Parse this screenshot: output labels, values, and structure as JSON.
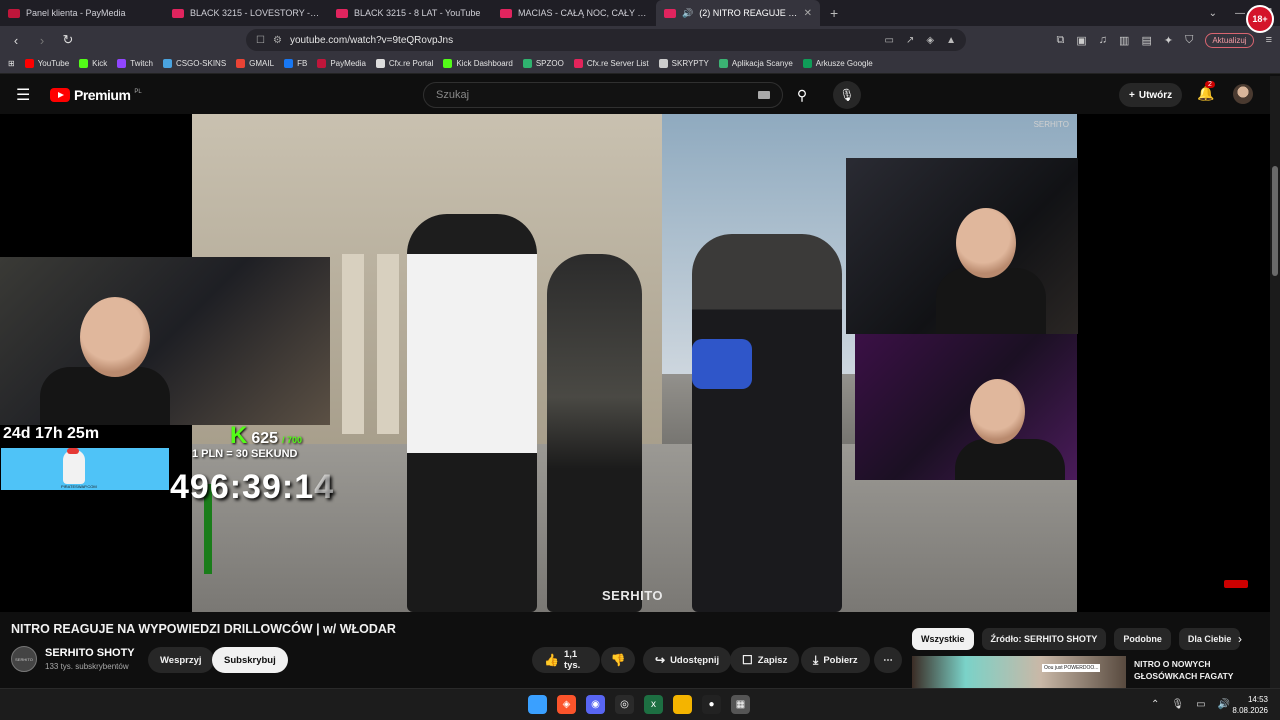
{
  "browser": {
    "tabs": [
      {
        "title": "Panel klienta - PayMedia",
        "active": false
      },
      {
        "title": "BLACK 3215 - LOVESTORY - YouTube",
        "active": false
      },
      {
        "title": "BLACK 3215 - 8 LAT - YouTube",
        "active": false
      },
      {
        "title": "MACIAS - CAŁĄ NOC, CAŁY DZIEŃ -",
        "active": false
      },
      {
        "title": "(2) NITRO REAGUJE NA WYPO",
        "active": true
      }
    ],
    "new_tab": "+",
    "url": "youtube.com/watch?v=9teQRovpJns",
    "update_label": "Aktualizuj",
    "age_badge": "18+"
  },
  "bookmarks": [
    {
      "label": "YouTube",
      "color": "#ff0000"
    },
    {
      "label": "Kick",
      "color": "#53fc18"
    },
    {
      "label": "Twitch",
      "color": "#9146ff"
    },
    {
      "label": "CSGO-SKINS",
      "color": "#4aa3df"
    },
    {
      "label": "GMAIL",
      "color": "#ea4335"
    },
    {
      "label": "FB",
      "color": "#1877f2"
    },
    {
      "label": "PayMedia",
      "color": "#c0163b"
    },
    {
      "label": "Cfx.re Portal",
      "color": "#dddddd"
    },
    {
      "label": "Kick Dashboard",
      "color": "#53fc18"
    },
    {
      "label": "SPZOO",
      "color": "#2fb36f"
    },
    {
      "label": "Cfx.re Server List",
      "color": "#e3245b"
    },
    {
      "label": "SKRYPTY",
      "color": "#cccccc"
    },
    {
      "label": "Aplikacja Scanye",
      "color": "#3bb273"
    },
    {
      "label": "Arkusze Google",
      "color": "#0f9d58"
    }
  ],
  "youtube": {
    "logo_text": "Premium",
    "logo_region": "PL",
    "search_placeholder": "Szukaj",
    "create_label": "Utwórz",
    "notif_count": "2"
  },
  "overlay": {
    "timer": "24d 17h 25m",
    "kick_count": "625",
    "kick_goal": "/ 700",
    "rate": "1 PLN = 30 SEKUND",
    "countdown_main": "496:39:1",
    "countdown_fade": "4",
    "rooster_site": "PIRATESWAP.COM",
    "video_watermark": "SERHITO",
    "corner_watermark": "SERHITO"
  },
  "video": {
    "title": "NITRO REAGUJE NA WYPOWIEDZI DRILLOWCÓW | w/ WŁODAR",
    "channel_name": "SERHITO SHOTY",
    "channel_subs": "133 tys. subskrybentów",
    "channel_avatar_text": "SERHITO",
    "support_label": "Wesprzyj",
    "subscribe_label": "Subskrybuj",
    "likes": "1,1 tys.",
    "share_label": "Udostępnij",
    "save_label": "Zapisz",
    "download_label": "Pobierz"
  },
  "chips": [
    "Wszystkie",
    "Źródło: SERHITO SHOTY",
    "Podobne",
    "Dla Ciebie"
  ],
  "recommendation": {
    "title": "NITRO O NOWYCH GŁOSÓWKACH FAGATY",
    "thumb_text": "Oou just POWERDOO..."
  },
  "taskbar": {
    "time": "14:53",
    "date": "8.08.2026"
  }
}
